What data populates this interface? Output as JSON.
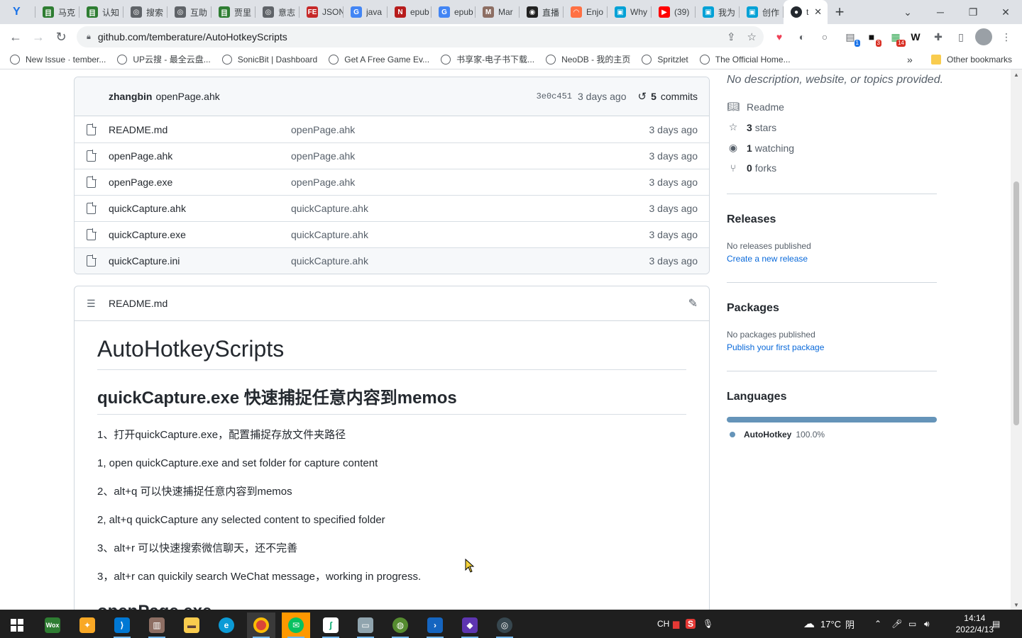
{
  "browser": {
    "tabs": [
      {
        "title": "马克",
        "color": "#2e7d32",
        "glyph": "目"
      },
      {
        "title": "认知",
        "color": "#2e7d32",
        "glyph": "目"
      },
      {
        "title": "搜索",
        "color": "#5f6368",
        "glyph": "◎"
      },
      {
        "title": "互助",
        "color": "#5f6368",
        "glyph": "◎"
      },
      {
        "title": "贾里",
        "color": "#2e7d32",
        "glyph": "目"
      },
      {
        "title": "意志",
        "color": "#5f6368",
        "glyph": "◎"
      },
      {
        "title": "JSON",
        "color": "#c62828",
        "glyph": "FE"
      },
      {
        "title": "java",
        "color": "#4285f4",
        "glyph": "G"
      },
      {
        "title": "epub",
        "color": "#b71c1c",
        "glyph": "N"
      },
      {
        "title": "epub",
        "color": "#4285f4",
        "glyph": "G"
      },
      {
        "title": "Mar",
        "color": "#8d6e63",
        "glyph": "M"
      },
      {
        "title": "直播",
        "color": "#212121",
        "glyph": "◉"
      },
      {
        "title": "Enjo",
        "color": "#ff7043",
        "glyph": "◠"
      },
      {
        "title": "Why",
        "color": "#00a1d6",
        "glyph": "▣"
      },
      {
        "title": "(39)",
        "color": "#ff0000",
        "glyph": "▶"
      },
      {
        "title": "我为",
        "color": "#00a1d6",
        "glyph": "▣"
      },
      {
        "title": "创作",
        "color": "#00a1d6",
        "glyph": "▣"
      }
    ],
    "active_tab_title": "t",
    "new_tab": "+",
    "url": "github.com/temberature/AutoHotkeyScripts",
    "bookmarks": [
      {
        "label": "New Issue · tember...",
        "icon": "github-icon"
      },
      {
        "label": "UP云搜 - 最全云盘...",
        "icon": "search-icon"
      },
      {
        "label": "SonicBit | Dashboard",
        "icon": "sonicbit-icon"
      },
      {
        "label": "Get A Free Game Ev...",
        "icon": "game-icon"
      },
      {
        "label": "书享家-电子书下载...",
        "icon": "globe-icon"
      },
      {
        "label": "NeoDB - 我的主页",
        "icon": "neodb-icon"
      },
      {
        "label": "Spritzlet",
        "icon": "globe-icon"
      },
      {
        "label": "The Official Home...",
        "icon": "leaf-icon"
      }
    ],
    "bookmarks_more": "»",
    "other_bookmarks": "Other bookmarks",
    "ext_badges": [
      "1",
      "3",
      "14"
    ]
  },
  "repo": {
    "commit": {
      "author": "zhangbin",
      "message": "openPage.ahk",
      "sha": "3e0c451",
      "time": "3 days ago",
      "count": "5",
      "count_label": "commits"
    },
    "files": [
      {
        "name": "README.md",
        "message": "openPage.ahk",
        "date": "3 days ago"
      },
      {
        "name": "openPage.ahk",
        "message": "openPage.ahk",
        "date": "3 days ago"
      },
      {
        "name": "openPage.exe",
        "message": "openPage.ahk",
        "date": "3 days ago"
      },
      {
        "name": "quickCapture.ahk",
        "message": "quickCapture.ahk",
        "date": "3 days ago"
      },
      {
        "name": "quickCapture.exe",
        "message": "quickCapture.ahk",
        "date": "3 days ago"
      },
      {
        "name": "quickCapture.ini",
        "message": "quickCapture.ahk",
        "date": "3 days ago"
      }
    ],
    "readme": {
      "filename": "README.md",
      "h1": "AutoHotkeyScripts",
      "h2": "quickCapture.exe 快速捕捉任意内容到memos",
      "paragraphs": [
        "1、打开quickCapture.exe，配置捕捉存放文件夹路径",
        "1, open quickCapture.exe and set folder for capture content",
        "2、alt+q 可以快速捕捉任意内容到memos",
        "2, alt+q quickCapture any selected content to specified folder",
        "3、alt+r 可以快速搜索微信聊天，还不完善",
        "3，alt+r can quickily search WeChat message，working in progress."
      ],
      "h2_next": "openPage.exe"
    }
  },
  "sidebar": {
    "description": "No description, website, or topics provided.",
    "readme_label": "Readme",
    "stars_count": "3",
    "stars_label": "stars",
    "watching_count": "1",
    "watching_label": "watching",
    "forks_count": "0",
    "forks_label": "forks",
    "releases_title": "Releases",
    "releases_empty": "No releases published",
    "releases_link": "Create a new release",
    "packages_title": "Packages",
    "packages_empty": "No packages published",
    "packages_link": "Publish your first package",
    "languages_title": "Languages",
    "language_name": "AutoHotkey",
    "language_percent": "100.0%",
    "language_color": "#6594b9"
  },
  "taskbar": {
    "weather_temp": "17°C",
    "weather_text": "阴",
    "ime": "CH",
    "time": "14:14",
    "date": "2022/4/13"
  }
}
